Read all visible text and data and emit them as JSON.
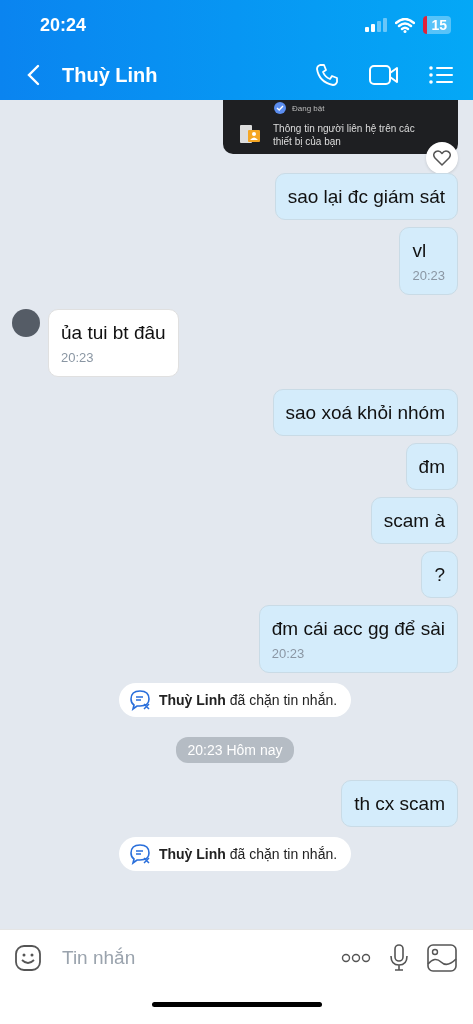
{
  "status_bar": {
    "time": "20:24",
    "battery": "15"
  },
  "header": {
    "title": "Thuỳ Linh"
  },
  "messages": [
    {
      "kind": "screenshot",
      "status": "Đang bật",
      "caption": "Thông tin người liên hệ trên các thiết bị của bạn",
      "reaction": true
    },
    {
      "kind": "outgoing",
      "text": "sao lại đc giám sát"
    },
    {
      "kind": "outgoing",
      "text": "vl",
      "time": "20:23"
    },
    {
      "kind": "incoming",
      "text": "ủa tui bt đâu",
      "time": "20:23"
    },
    {
      "kind": "outgoing",
      "text": "sao xoá khỏi nhóm"
    },
    {
      "kind": "outgoing",
      "text": "đm"
    },
    {
      "kind": "outgoing",
      "text": "scam à"
    },
    {
      "kind": "outgoing",
      "text": "?"
    },
    {
      "kind": "outgoing",
      "text": "đm cái acc gg để sài",
      "time": "20:23"
    },
    {
      "kind": "notice",
      "text": "**Thuỳ Linh** đã chặn tin nhắn."
    },
    {
      "kind": "time",
      "text": "20:23 Hôm nay"
    },
    {
      "kind": "outgoing",
      "text": "th cx scam"
    },
    {
      "kind": "notice",
      "text": "**Thuỳ Linh** đã chặn tin nhắn."
    }
  ],
  "composer": {
    "placeholder": "Tin nhắn"
  }
}
